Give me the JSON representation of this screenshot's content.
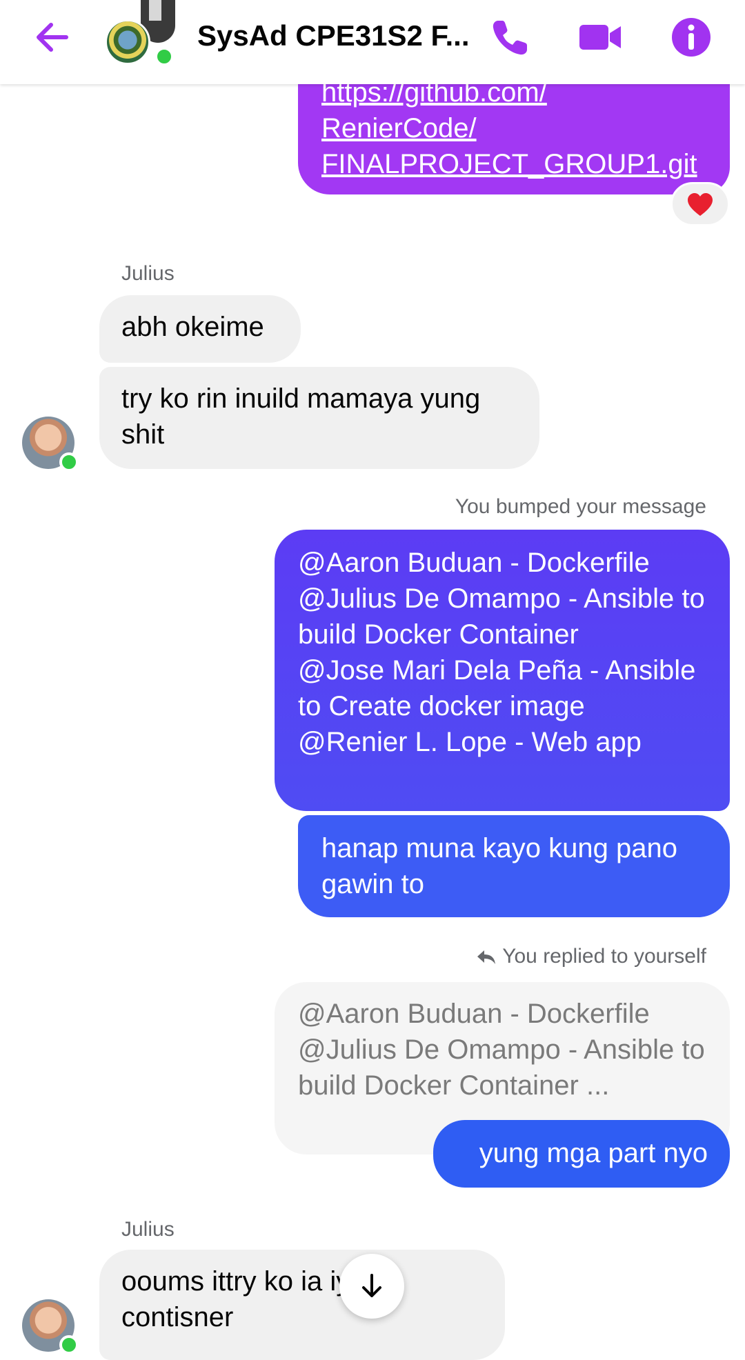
{
  "header": {
    "title": "SysAd CPE31S2 F...",
    "icons": {
      "back": "arrow-left-icon",
      "call": "phone-icon",
      "video": "video-camera-icon",
      "info": "info-icon"
    },
    "accent_color": "#a133f0",
    "online_color": "#31cc46"
  },
  "messages": {
    "link_message": "https://github.com/\nRenierCode/\nFINALPROJECT_GROUP1.git",
    "reaction": "heart",
    "julius_name_1": "Julius",
    "julius_msg_1": "abh okeime",
    "julius_msg_2": "try ko rin inuild mamaya yung shit",
    "bumped_label": "You bumped your message",
    "assignment_message": "@Aaron Buduan - Dockerfile\n@Julius De Omampo - Ansible to build Docker Container\n@Jose Mari Dela Peña - Ansible to Create docker image\n@Renier L. Lope - Web app",
    "hanap_message": "hanap muna kayo kung pano gawin  to",
    "replied_label": "You replied to yourself",
    "quoted_message": "@Aaron Buduan - Dockerfile\n@Julius De Omampo - Ansible to build Docker Container ...",
    "reply_message": "yung mga part nyo",
    "julius_name_2": "Julius",
    "julius_msg_3": "ooums ittry ko ia      iya sa contisner"
  }
}
